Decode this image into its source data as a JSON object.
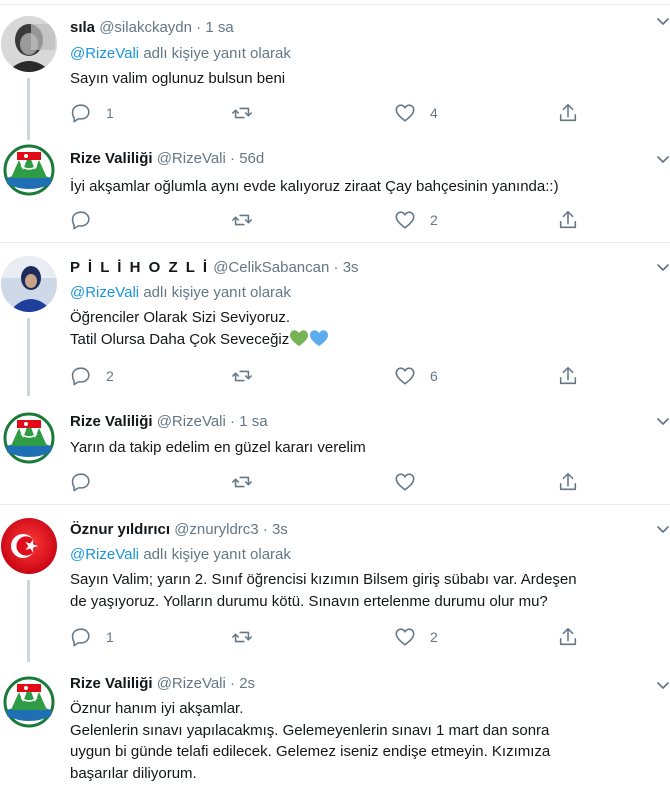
{
  "reply_prefix": "adlı kişiye yanıt olarak",
  "tweets": [
    {
      "name": "sıla",
      "handle": "@silakckaydn",
      "time": "1 sa",
      "reply_to": "@RizeVali",
      "lines": [
        "Sayın valim oglunuz bulsun beni"
      ],
      "replies": "1",
      "retweets": "",
      "likes": "4"
    },
    {
      "name": "Rize Valiliği",
      "handle": "@RizeVali",
      "time": "56d",
      "reply_to": "",
      "lines": [
        "İyi akşamlar oğlumla aynı evde kalıyoruz ziraat Çay bahçesinin yanında::)"
      ],
      "replies": "",
      "retweets": "",
      "likes": "2"
    },
    {
      "name": "P İ L İ H O Z L İ",
      "handle": "@CelikSabancan",
      "time": "3s",
      "reply_to": "@RizeVali",
      "lines": [
        "Öğrenciler Olarak Sizi Seviyoruz.",
        "Tatil Olursa Daha Çok Seveceğiz"
      ],
      "emoji": [
        "green-heart",
        "blue-heart"
      ],
      "replies": "2",
      "retweets": "",
      "likes": "6"
    },
    {
      "name": "Rize Valiliği",
      "handle": "@RizeVali",
      "time": "1 sa",
      "reply_to": "",
      "lines": [
        "Yarın da takip edelim en güzel kararı verelim"
      ],
      "replies": "",
      "retweets": "",
      "likes": ""
    },
    {
      "name": "Öznur yıldırıcı",
      "handle": "@znuryldrc3",
      "time": "3s",
      "reply_to": "@RizeVali",
      "lines": [
        "Sayın Valim; yarın 2. Sınıf öğrencisi kızımın Bilsem giriş sübabı var. Ardeşen",
        "de yaşıyoruz. Yolların durumu kötü. Sınavın ertelenme durumu olur mu?"
      ],
      "replies": "1",
      "retweets": "",
      "likes": "2"
    },
    {
      "name": "Rize Valiliği",
      "handle": "@RizeVali",
      "time": "2s",
      "reply_to": "",
      "lines": [
        "Öznur hanım iyi akşamlar.",
        "Gelenlerin sınavı yapılacakmış. Gelemeyenlerin sınavı 1 mart dan sonra",
        "uygun bi günde telafi edilecek. Gelemez iseniz endişe etmeyin. Kızımıza",
        "başarılar diliyorum."
      ],
      "replies": "",
      "retweets": "",
      "likes": ""
    }
  ]
}
